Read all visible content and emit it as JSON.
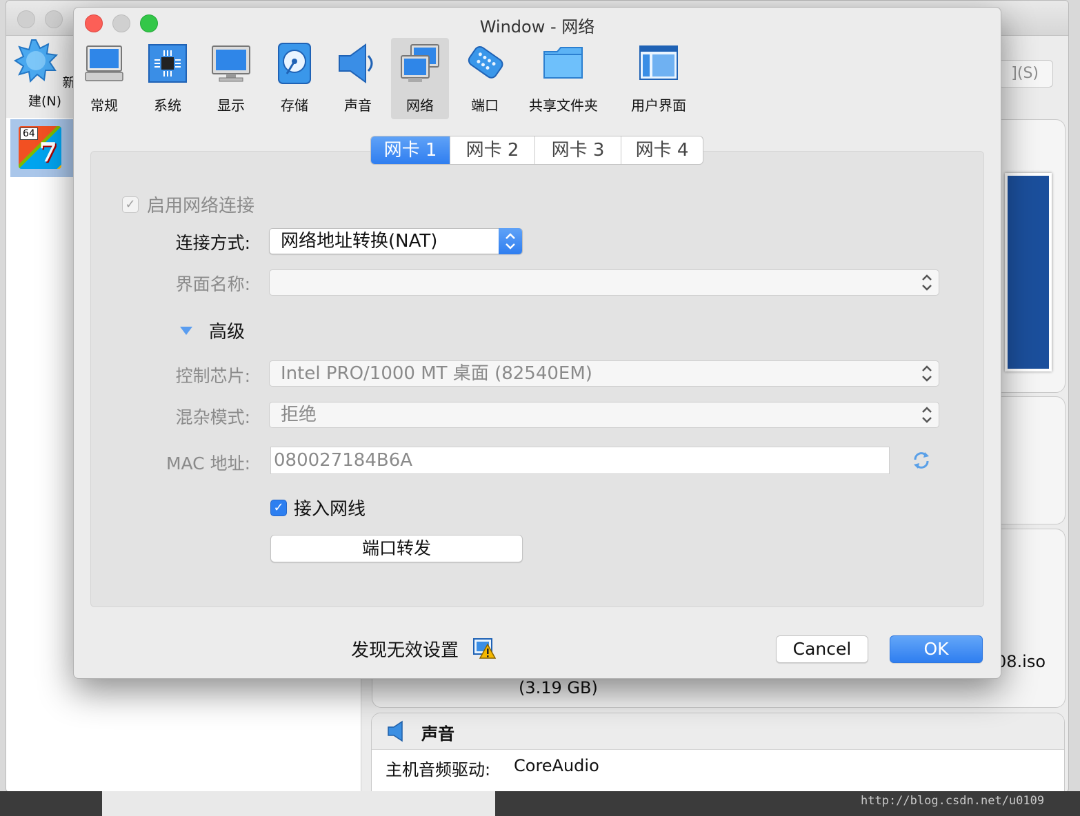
{
  "background": {
    "new_button_label": "新建(N)",
    "vm_badge_bits": "64",
    "vm_badge_digit": "7",
    "search_button_tail": "](S)",
    "storage_size": "(3.19 GB)",
    "iso_tail": "08.iso",
    "audio_section_title": "声音",
    "audio_driver_key": "主机音频驱动:",
    "audio_driver_value": "CoreAudio",
    "watermark": "http://blog.csdn.net/u0109"
  },
  "window": {
    "title": "Window - 网络"
  },
  "toolbar": {
    "items": [
      {
        "label": "常规",
        "icon": "monitor-general-icon"
      },
      {
        "label": "系统",
        "icon": "chip-system-icon"
      },
      {
        "label": "显示",
        "icon": "display-icon"
      },
      {
        "label": "存储",
        "icon": "disk-storage-icon"
      },
      {
        "label": "声音",
        "icon": "speaker-icon"
      },
      {
        "label": "网络",
        "icon": "network-icon",
        "active": true
      },
      {
        "label": "端口",
        "icon": "serial-port-icon"
      },
      {
        "label": "共享文件夹",
        "icon": "folder-icon"
      },
      {
        "label": "用户界面",
        "icon": "user-interface-icon"
      }
    ]
  },
  "tabs": [
    "网卡 1",
    "网卡 2",
    "网卡 3",
    "网卡 4"
  ],
  "active_tab": "网卡 1",
  "form": {
    "enable_network_label": "启用网络连接",
    "enable_network_checked": true,
    "attached_to_label": "连接方式:",
    "attached_to_value": "网络地址转换(NAT)",
    "name_label": "界面名称:",
    "name_value": "",
    "advanced_label": "高级",
    "adapter_type_label": "控制芯片:",
    "adapter_type_value": "Intel PRO/1000 MT 桌面 (82540EM)",
    "promiscuous_label": "混杂模式:",
    "promiscuous_value": "拒绝",
    "mac_label": "MAC 地址:",
    "mac_value": "080027184B6A",
    "cable_connected_label": "接入网线",
    "cable_connected_checked": true,
    "port_forwarding_button": "端口转发"
  },
  "footer": {
    "invalid_settings_text": "发现无效设置",
    "cancel_button": "Cancel",
    "ok_button": "OK"
  },
  "colors": {
    "accent": "#2f7ef0",
    "close": "#fc5f57",
    "maximize": "#33c748"
  }
}
